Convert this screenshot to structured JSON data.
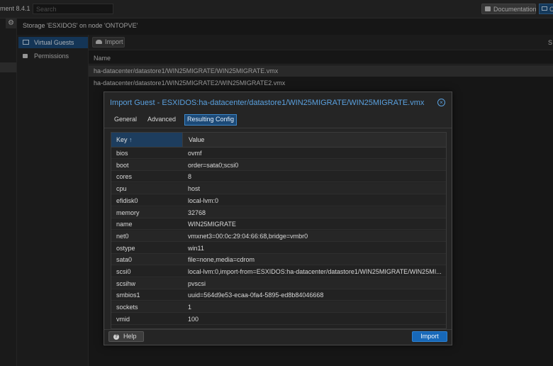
{
  "header": {
    "brand": "ment 8.4.1",
    "search_placeholder": "Search",
    "documentation_label": "Documentation",
    "create_label": "C"
  },
  "storage_title": "Storage 'ESXIDOS' on node 'ONTOPVE'",
  "subnav": {
    "items": [
      {
        "label": "Virtual Guests",
        "icon": "monitor-icon",
        "active": true
      },
      {
        "label": "Permissions",
        "icon": "lock-icon",
        "active": false
      }
    ]
  },
  "toolbar": {
    "import_label": "Import",
    "right_label": "S"
  },
  "table": {
    "column_name": "Name",
    "rows": [
      "ha-datacenter/datastore1/WIN25MIGRATE/WIN25MIGRATE.vmx",
      "ha-datacenter/datastore1/WIN25MIGRATE2/WIN25MIGRATE2.vmx"
    ]
  },
  "modal": {
    "title": "Import Guest - ESXIDOS:ha-datacenter/datastore1/WIN25MIGRATE/WIN25MIGRATE.vmx",
    "tabs": [
      {
        "label": "General",
        "active": false
      },
      {
        "label": "Advanced",
        "active": false
      },
      {
        "label": "Resulting Config",
        "active": true
      }
    ],
    "grid": {
      "key_header": "Key",
      "sort_arrow": "↑",
      "value_header": "Value",
      "rows": [
        {
          "key": "bios",
          "value": "ovmf"
        },
        {
          "key": "boot",
          "value": "order=sata0;scsi0"
        },
        {
          "key": "cores",
          "value": "8"
        },
        {
          "key": "cpu",
          "value": "host"
        },
        {
          "key": "efidisk0",
          "value": "local-lvm:0"
        },
        {
          "key": "memory",
          "value": "32768"
        },
        {
          "key": "name",
          "value": "WIN25MIGRATE"
        },
        {
          "key": "net0",
          "value": "vmxnet3=00:0c:29:04:66:68,bridge=vmbr0"
        },
        {
          "key": "ostype",
          "value": "win11"
        },
        {
          "key": "sata0",
          "value": "file=none,media=cdrom"
        },
        {
          "key": "scsi0",
          "value": "local-lvm:0,import-from=ESXIDOS:ha-datacenter/datastore1/WIN25MIGRATE/WIN25MI..."
        },
        {
          "key": "scsihw",
          "value": "pvscsi"
        },
        {
          "key": "smbios1",
          "value": "uuid=564d9e53-ecaa-0fa4-5895-ed8b84046668"
        },
        {
          "key": "sockets",
          "value": "1"
        },
        {
          "key": "vmid",
          "value": "100"
        }
      ]
    },
    "help_label": "Help",
    "import_label": "Import"
  },
  "colors": {
    "accent": "#5aa0de",
    "primary_button": "#1768b8",
    "active_nav": "#1c4a78"
  }
}
